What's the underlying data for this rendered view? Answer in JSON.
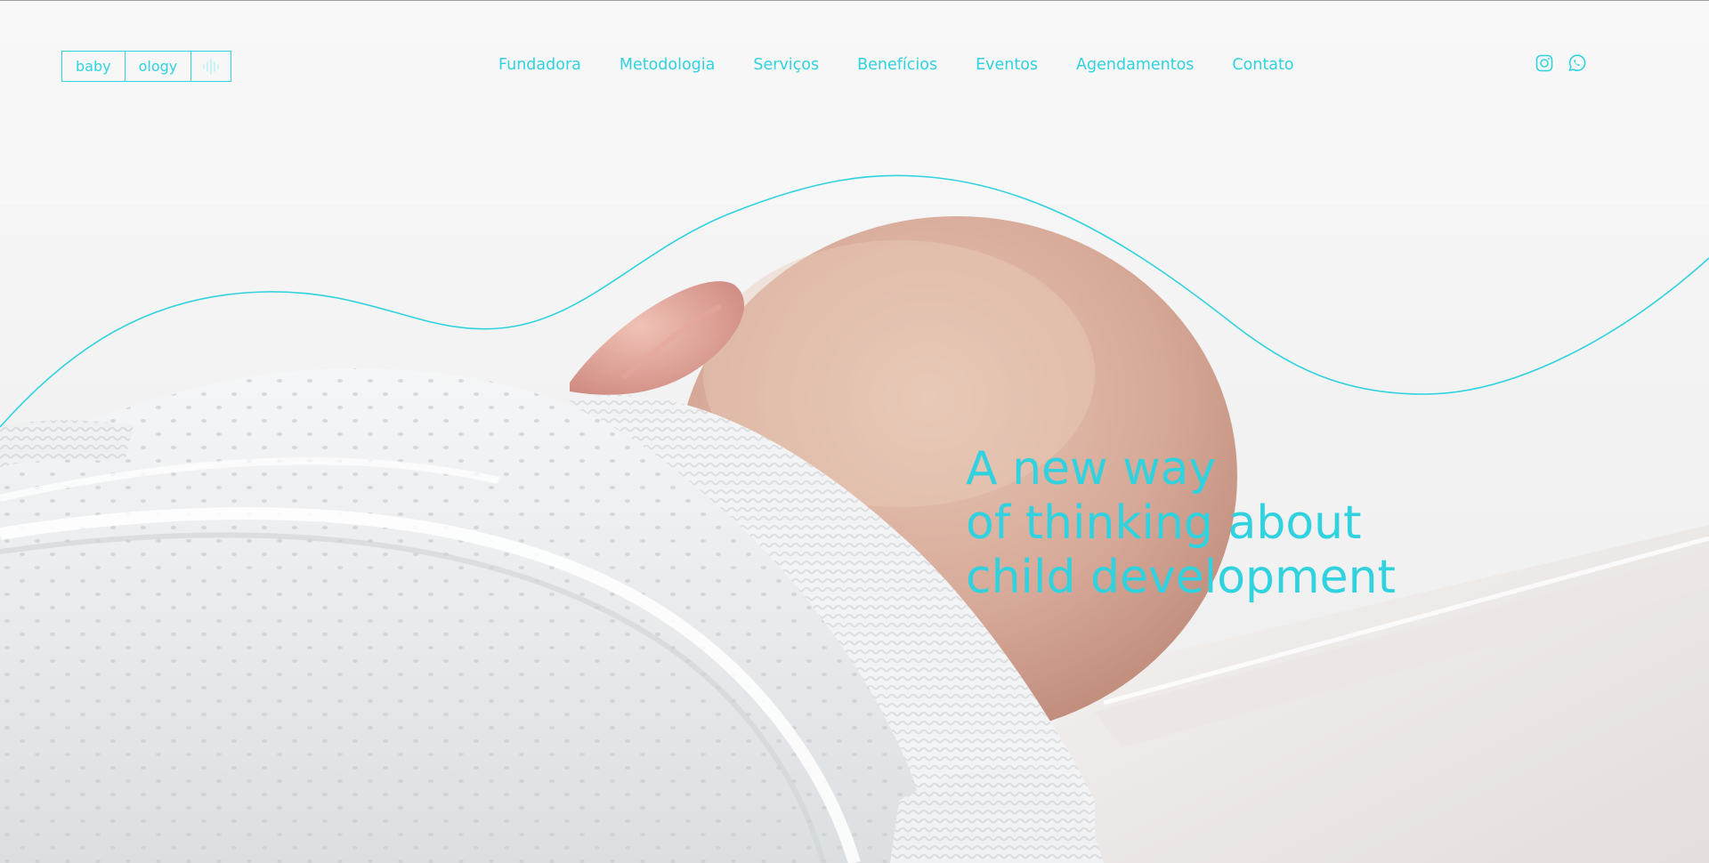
{
  "theme": {
    "accent": "#2fd2de"
  },
  "logo": {
    "part1": "baby",
    "part2": "ology",
    "icon": "soundwave-icon"
  },
  "nav": {
    "items": [
      {
        "label": "Fundadora"
      },
      {
        "label": "Metodologia"
      },
      {
        "label": "Serviços"
      },
      {
        "label": "Benefícios"
      },
      {
        "label": "Eventos"
      },
      {
        "label": "Agendamentos"
      },
      {
        "label": "Contato"
      }
    ]
  },
  "social": {
    "instagram_icon": "instagram-icon",
    "whatsapp_icon": "whatsapp-icon"
  },
  "hero": {
    "line1": "A new way",
    "line2": "of thinking about",
    "line3": "child development",
    "image": "sleeping-baby-photo"
  }
}
